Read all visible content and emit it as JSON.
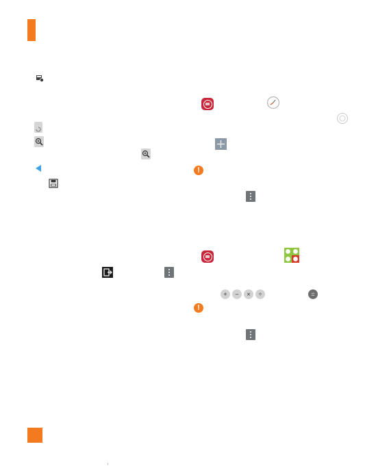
{
  "page": {
    "accent_color": "#f47a20",
    "apps_icon_color": "#c8263a",
    "menu_icon_color": "#6f7478"
  },
  "icons": {
    "gallery_settings": "image-settings-icon",
    "apps": "apps-icon",
    "clock": "clock-app-icon",
    "alarm": "alarm-circle-icon",
    "rotate": "rotate-icon",
    "zoom": "zoom-icon",
    "add": "plus-icon",
    "warning": "warning-icon",
    "previous": "back-triangle-icon",
    "save": "save-icon",
    "menu": "menu-icon",
    "calculator": "calculator-app-icon",
    "export": "export-icon"
  },
  "calculator": {
    "operators": [
      "+",
      "−",
      "×",
      "÷"
    ],
    "equals": "="
  },
  "footer_mark": "ᵢ"
}
